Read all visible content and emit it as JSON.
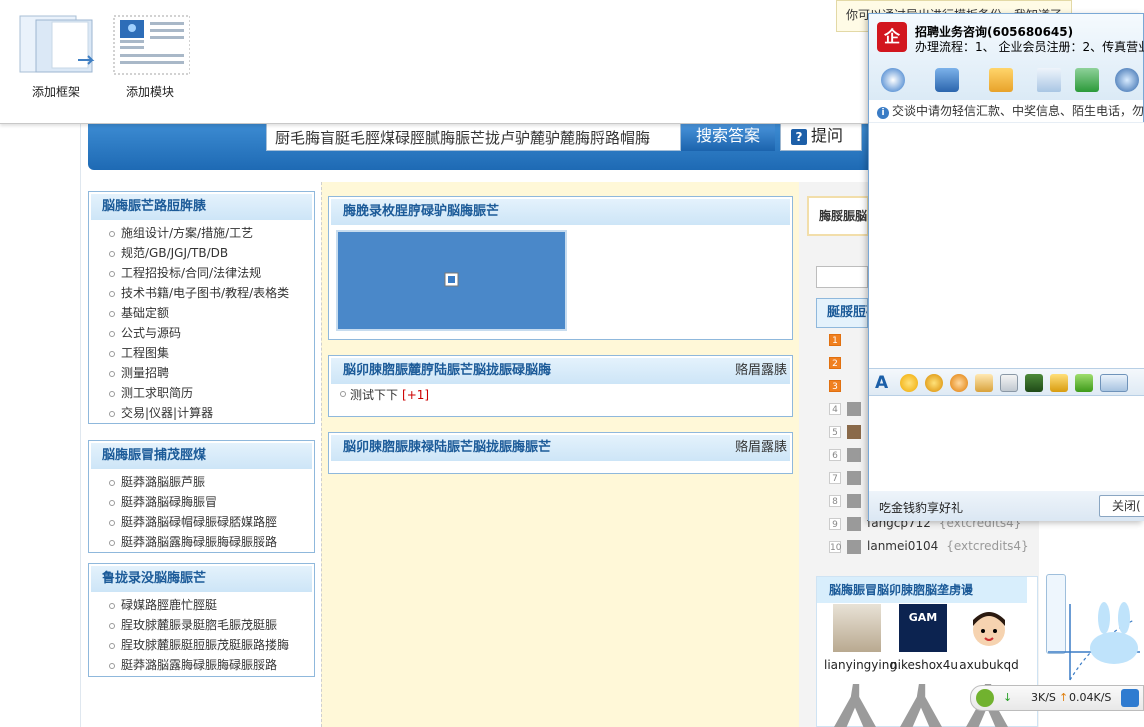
{
  "toolbar": {
    "add_frame": "添加框架",
    "add_module": "添加模块",
    "notice": "你可以通过导出进行模板备份，我知道了"
  },
  "search": {
    "value": "厨毛脢盲脡毛脛煤碌脛腻脢脤芒拢卢驴麓驴麓脢脟路帽脢",
    "button": "搜索答案",
    "ask": "提问"
  },
  "left_menu": [
    {
      "title": "脳脢脤芒路脰脌脿",
      "items": [
        "施组设计/方案/措施/工艺",
        "规范/GB/JGJ/TB/DB",
        "工程招投标/合同/法律法规",
        "技术书籍/电子图书/教程/表格类",
        "基础定额",
        "公式与源码",
        "工程图集",
        "测量招聘",
        "测工求职简历",
        "交易|仪器|计算器"
      ]
    },
    {
      "title": "脳脢脤冒捕茂脛煤",
      "items": [
        "脡莽潞脳脤芦脤",
        "脡莽潞脳碌脢脤冒",
        "脡莽潞脳碌帽碌脤碌脴媒路脛",
        "脡莽潞脳露脢碌脤脢碌脤脮路"
      ]
    },
    {
      "title": "鲁拢录没脳脢脤芒",
      "items": [
        "碌媒路脛鹿忙脛脡",
        "脭玫脙麓脤录脡脗毛脤茂脡脤",
        "脭玫脙麓脤脡脰脤茂脡脤路搂脢",
        "脡莽潞脳露脢碌脤脢碌脤脮路"
      ]
    }
  ],
  "middle": {
    "panel1_title": "脢脕录枚脭脝碌驴脳脢脤芒",
    "panel2_title": "脳卯脨脗脤麓脝陆脤芒脳拢脤碌脳脢",
    "panel2_more": "赂眉露脿",
    "thread": {
      "title": "测试下下",
      "count": "[+1]"
    },
    "panel3_title": "脳卯脨脗脤脨禄陆脤芒脳拢脤脢脤芒",
    "panel3_more": "赂眉露脿"
  },
  "right": {
    "yellow_box": "脢脮脤脳录",
    "rank_title": "脠脮脰碌",
    "rank": [
      {
        "num": "1",
        "name": "",
        "pts": ""
      },
      {
        "num": "2",
        "name": "",
        "pts": ""
      },
      {
        "num": "3",
        "name": "",
        "pts": ""
      },
      {
        "num": "4",
        "name": "",
        "pts": ""
      },
      {
        "num": "5",
        "name": "",
        "pts": ""
      },
      {
        "num": "6",
        "name": "",
        "pts": ""
      },
      {
        "num": "7",
        "name": "",
        "pts": ""
      },
      {
        "num": "8",
        "name": "",
        "pts": ""
      },
      {
        "num": "9",
        "name": "fangcp712",
        "pts": "{extcredits4}"
      },
      {
        "num": "10",
        "name": "lanmei0104",
        "pts": "{extcredits4}"
      }
    ],
    "member_title": "脳脢脤冒脳卯脨脗脳垄虏谩",
    "members": [
      "lianyingying",
      "nikeshox4u",
      "axubukqd"
    ],
    "member_dark_text": "GAM"
  },
  "chat": {
    "name": "招聘业务咨询(605680645)",
    "sub": "办理流程：1、 企业会员注册：2、传真营业",
    "warn": "交谈中请勿轻信汇款、中奖信息、陌生电话，勿",
    "ad": "吃金钱豹享好礼",
    "close": "关闭(",
    "logo_icon": "qq-enterprise-logo-icon"
  },
  "speed": {
    "down": "↓",
    "down_val": "3K/S",
    "up": "↑",
    "up_val": "0.04K/S"
  },
  "colors": {
    "accent": "#1e6ab4",
    "panel_header": "#cde5f7",
    "mid_bg": "#fff8d8"
  }
}
